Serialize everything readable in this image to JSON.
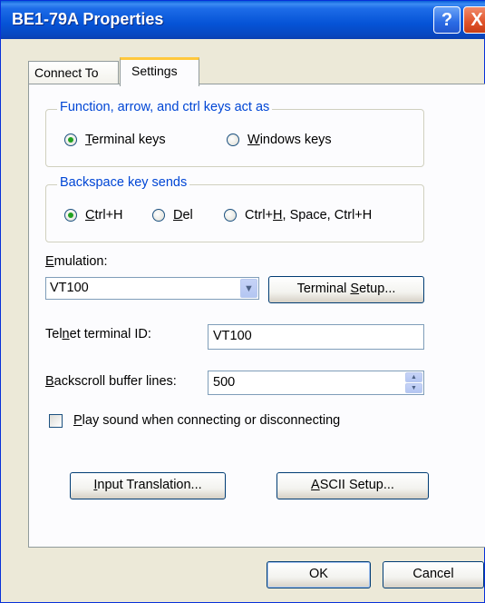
{
  "window": {
    "title": "BE1-79A Properties",
    "help_glyph": "?",
    "close_glyph": "X"
  },
  "tabs": [
    {
      "label": "Connect To"
    },
    {
      "label": "Settings"
    }
  ],
  "function_keys": {
    "legend": "Function, arrow, and ctrl keys act as",
    "terminal_keys_pre": "",
    "terminal_keys_ul": "T",
    "terminal_keys_post": "erminal keys",
    "windows_keys_pre": "",
    "windows_keys_ul": "W",
    "windows_keys_post": "indows keys",
    "selected": "terminal"
  },
  "backspace": {
    "legend": "Backspace key sends",
    "ctrl_h_pre": "",
    "ctrl_h_ul": "C",
    "ctrl_h_post": "trl+H",
    "del_pre": "",
    "del_ul": "D",
    "del_post": "el",
    "combo_pre": "Ctrl+",
    "combo_ul": "H",
    "combo_post": ", Space, Ctrl+H",
    "selected": "ctrl_h"
  },
  "emulation": {
    "label_ul": "E",
    "label_post": "mulation:",
    "value": "VT100",
    "setup_pre": "Terminal ",
    "setup_ul": "S",
    "setup_post": "etup..."
  },
  "telnet": {
    "label_pre": "Tel",
    "label_ul": "n",
    "label_post": "et terminal ID:",
    "value": "VT100"
  },
  "backscroll": {
    "label_ul": "B",
    "label_post": "ackscroll buffer lines:",
    "value": "500",
    "spin_up": "▲",
    "spin_down": "▼"
  },
  "play_sound": {
    "label_ul": "P",
    "label_post": "lay sound when connecting or disconnecting",
    "checked": false
  },
  "input_translation": {
    "ul": "I",
    "post": "nput Translation..."
  },
  "ascii_setup": {
    "ul": "A",
    "post": "SCII Setup..."
  },
  "footer": {
    "ok": "OK",
    "cancel": "Cancel"
  },
  "colors": {
    "accent": "#0046d5",
    "title_bar": "#0553d6",
    "tab_highlight": "#ffc83c"
  }
}
